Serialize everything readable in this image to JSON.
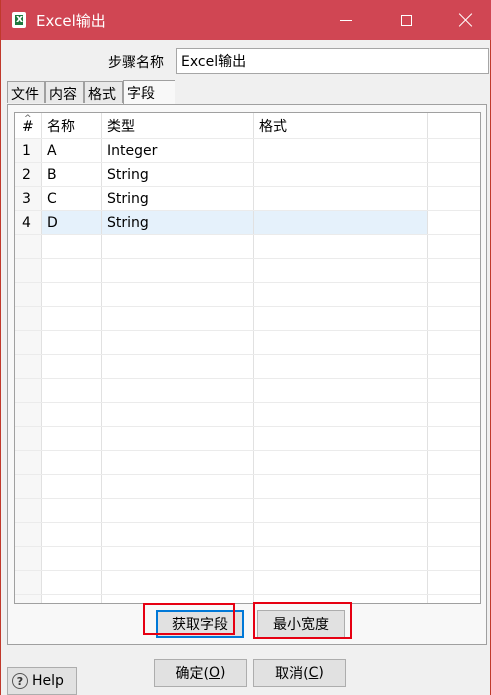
{
  "window": {
    "title": "Excel输出",
    "icon": "excel-icon",
    "accent_color": "#d04653"
  },
  "step": {
    "label": "步骤名称",
    "value": "Excel输出"
  },
  "tabs": [
    {
      "label": "文件"
    },
    {
      "label": "内容"
    },
    {
      "label": "格式"
    },
    {
      "label": "字段",
      "active": true
    }
  ],
  "grid": {
    "headers": {
      "num": "#",
      "name": "名称",
      "type": "类型",
      "format": "格式"
    },
    "rows": [
      {
        "num": "1",
        "name": "A",
        "type": "Integer",
        "format": ""
      },
      {
        "num": "2",
        "name": "B",
        "type": "String",
        "format": ""
      },
      {
        "num": "3",
        "name": "C",
        "type": "String",
        "format": ""
      },
      {
        "num": "4",
        "name": "D",
        "type": "String",
        "format": ""
      }
    ],
    "selected_row": 4
  },
  "buttons": {
    "get_fields": "获取字段",
    "min_width": "最小宽度",
    "ok_prefix": "确定(",
    "ok_key": "O",
    "ok_suffix": ")",
    "cancel_prefix": "取消(",
    "cancel_key": "C",
    "cancel_suffix": ")",
    "help": "Help"
  },
  "highlight_color": "#e60012"
}
